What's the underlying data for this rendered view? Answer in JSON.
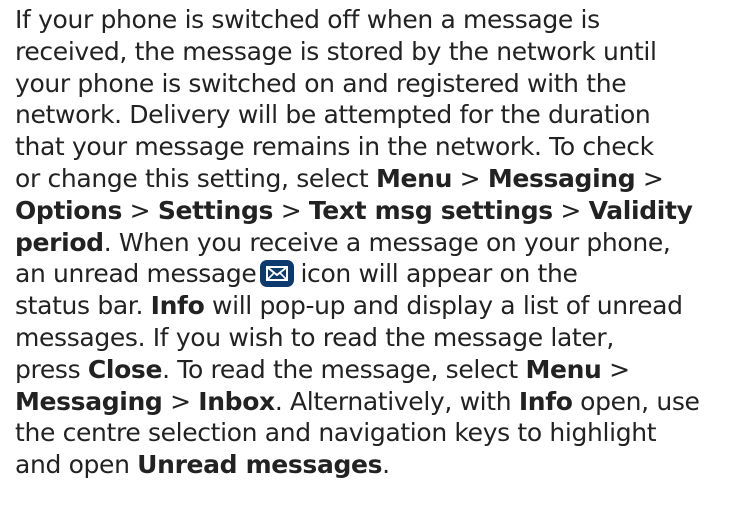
{
  "paragraph": {
    "l1": "If your phone is switched off when a message is",
    "l2": "received, the message is stored by the network until",
    "l3": "your phone is switched on and registered with the",
    "l4": "network. Delivery will be attempted for the duration",
    "l5": "that your message remains in the network. To check",
    "l6a": "or change this setting, select ",
    "l6_menu": "Menu",
    "l6_sep1": " > ",
    "l6_messaging": "Messaging",
    "l6_sep2": " >",
    "l7_options": "Options",
    "l7_sep1": " > ",
    "l7_settings": "Settings",
    "l7_sep2": " > ",
    "l7_textmsg": "Text msg settings",
    "l7_sep3": " > ",
    "l7_validity": "Validity",
    "l8_period": "period",
    "l8_rest": ". When you receive a message on your phone,",
    "l9a": "an unread message",
    "l9b": "icon will appear on the",
    "l10_info": "Info",
    "l10_rest": " will pop-up and display a list of unread",
    "l10a": "status bar. ",
    "l11": "messages. If you wish to read the message later,",
    "l12a": "press ",
    "l12_close": "Close",
    "l12b": ". To read the message, select ",
    "l12_menu": "Menu",
    "l12c": " >",
    "l13_messaging": "Messaging",
    "l13_sep": " > ",
    "l13_inbox": "Inbox",
    "l13b": ". Alternatively, with ",
    "l13_info": "Info",
    "l13c": " open, use",
    "l14": "the centre selection and navigation keys to highlight",
    "l15a": "and open ",
    "l15_unread": "Unread messages",
    "l15b": "."
  },
  "icons": {
    "unread_message_icon": "envelope-icon",
    "icon_color": "#0d3a6e"
  }
}
